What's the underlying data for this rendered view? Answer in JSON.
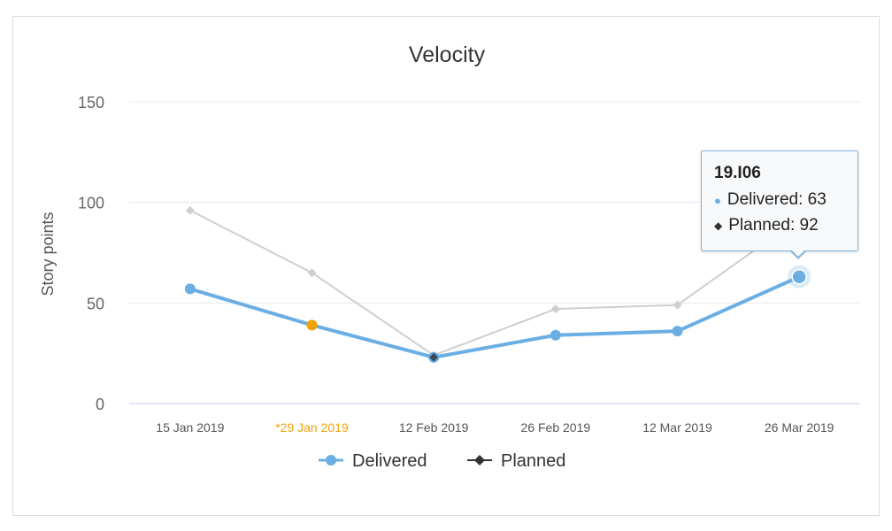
{
  "chart_data": {
    "type": "line",
    "title": "Velocity",
    "xlabel": "",
    "ylabel": "Story points",
    "ylim": [
      0,
      150
    ],
    "yticks": [
      0,
      50,
      100,
      150
    ],
    "categories": [
      "15 Jan 2019",
      "*29 Jan 2019",
      "12 Feb 2019",
      "26 Feb 2019",
      "12 Mar 2019",
      "26 Mar 2019"
    ],
    "highlighted_category_index": 1,
    "highlighted_category_color": "#f0a20a",
    "grid": true,
    "legend_position": "bottom",
    "series": [
      {
        "name": "Delivered",
        "values": [
          57,
          39,
          23,
          34,
          36,
          63
        ],
        "color": "#6aaee3"
      },
      {
        "name": "Planned",
        "values": [
          96,
          65,
          24,
          47,
          49,
          92
        ],
        "color": "#cfcfcf",
        "legend_color": "#333333"
      }
    ],
    "highlighted_point": {
      "series": "Delivered",
      "index": 1,
      "color": "#f0a20a"
    },
    "tooltip": {
      "title": "19.I06",
      "delivered_text": "Delivered: 63",
      "planned_text": "Planned: 92"
    }
  }
}
